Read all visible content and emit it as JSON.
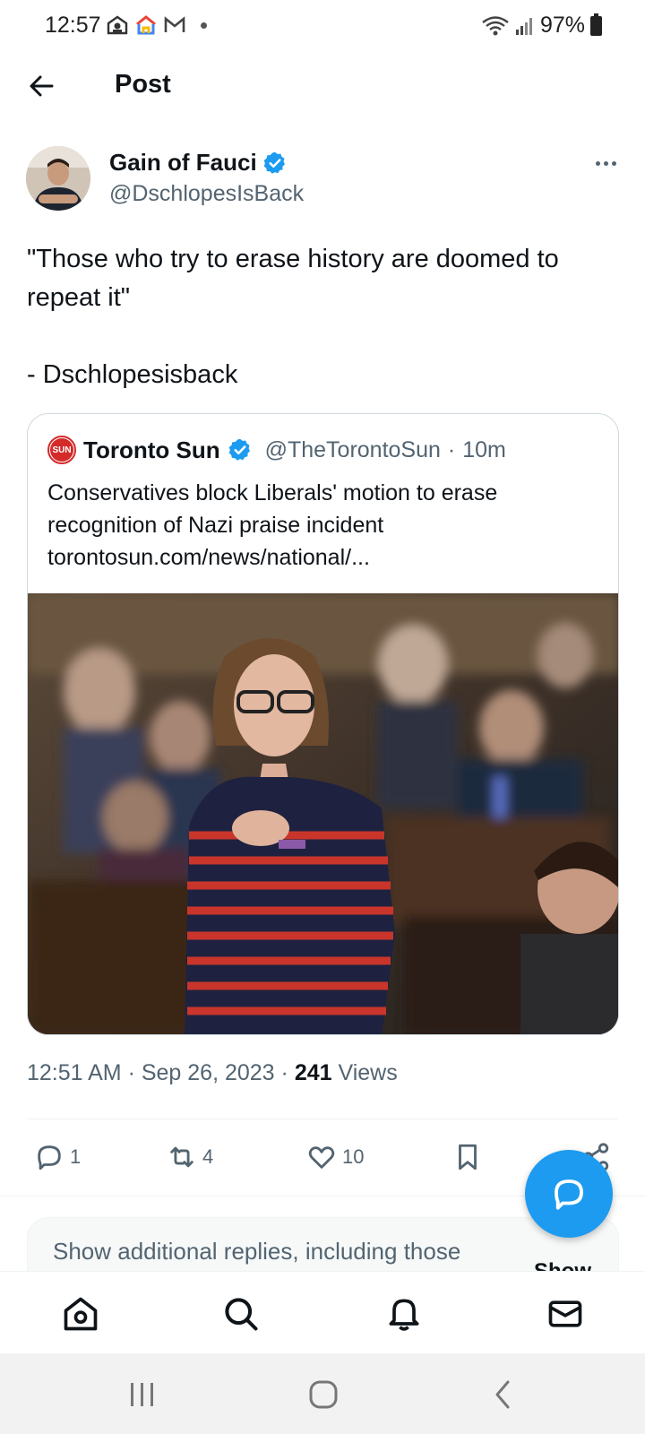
{
  "status_bar": {
    "time": "12:57",
    "battery": "97%",
    "left_icons": [
      "drive-icon",
      "google-home-icon",
      "gmail-icon",
      "dot"
    ],
    "right_icons": [
      "wifi-icon",
      "signal-icon",
      "battery-icon"
    ]
  },
  "header": {
    "title": "Post"
  },
  "post": {
    "author_name": "Gain of Fauci",
    "author_handle": "@DschlopesIsBack",
    "verified": true,
    "text_lines": [
      "\"Those who try to erase history are doomed to",
      "repeat it\""
    ],
    "signature": "- Dschlopesisback",
    "quote": {
      "source_logo_text": "SUN",
      "source_name": "Toronto Sun",
      "source_handle": "@TheTorontoSun",
      "separator": "·",
      "time": "10m",
      "text_lines": [
        "Conservatives block Liberals' motion to erase",
        "recognition of Nazi praise incident",
        "torontosun.com/news/national/..."
      ]
    },
    "meta": {
      "timestamp": "12:51 AM · Sep 26, 2023 · ",
      "views_count": "241",
      "views_label": " Views"
    },
    "actions": {
      "replies": "1",
      "reposts": "4",
      "likes": "10"
    }
  },
  "additional_replies": {
    "text": "Show additional replies, including those",
    "button": "Show"
  },
  "colors": {
    "accent": "#1d9bf0",
    "secondary_text": "#536471",
    "primary_text": "#0f1419",
    "toronto_sun_red": "#d42a2a"
  }
}
